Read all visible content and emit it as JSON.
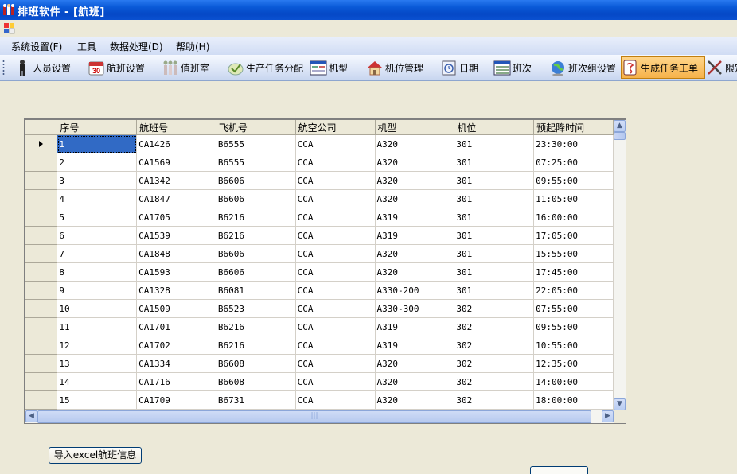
{
  "window": {
    "title": "排班软件 - [航班]"
  },
  "menu": [
    {
      "label": "系统设置(F)"
    },
    {
      "label": "工具"
    },
    {
      "label": "数据处理(D)"
    },
    {
      "label": "帮助(H)"
    }
  ],
  "toolbar": [
    {
      "label": "人员设置",
      "icon": "person-icon"
    },
    {
      "label": "航班设置",
      "icon": "calendar-30-icon"
    },
    {
      "label": "值班室",
      "icon": "people-group-icon"
    },
    {
      "label": "生产任务分配",
      "icon": "task-assign-icon"
    },
    {
      "label": "机型",
      "icon": "window-form-icon"
    },
    {
      "label": "机位管理",
      "icon": "house-icon"
    },
    {
      "label": "日期",
      "icon": "date-icon"
    },
    {
      "label": "班次",
      "icon": "form-list-icon"
    },
    {
      "label": "班次组设置",
      "icon": "globe-icon"
    },
    {
      "label": "生成任务工单",
      "icon": "generate-worksheet-icon",
      "active": true
    },
    {
      "label": "限定",
      "icon": "tools-cross-icon"
    }
  ],
  "grid": {
    "columns": [
      "序号",
      "航班号",
      "飞机号",
      "航空公司",
      "机型",
      "机位",
      "预起降时间"
    ],
    "rows": [
      [
        "1",
        "CA1426",
        "B6555",
        "CCA",
        "A320",
        "301",
        "23:30:00"
      ],
      [
        "2",
        "CA1569",
        "B6555",
        "CCA",
        "A320",
        "301",
        "07:25:00"
      ],
      [
        "3",
        "CA1342",
        "B6606",
        "CCA",
        "A320",
        "301",
        "09:55:00"
      ],
      [
        "4",
        "CA1847",
        "B6606",
        "CCA",
        "A320",
        "301",
        "11:05:00"
      ],
      [
        "5",
        "CA1705",
        "B6216",
        "CCA",
        "A319",
        "301",
        "16:00:00"
      ],
      [
        "6",
        "CA1539",
        "B6216",
        "CCA",
        "A319",
        "301",
        "17:05:00"
      ],
      [
        "7",
        "CA1848",
        "B6606",
        "CCA",
        "A320",
        "301",
        "15:55:00"
      ],
      [
        "8",
        "CA1593",
        "B6606",
        "CCA",
        "A320",
        "301",
        "17:45:00"
      ],
      [
        "9",
        "CA1328",
        "B6081",
        "CCA",
        "A330-200",
        "301",
        "22:05:00"
      ],
      [
        "10",
        "CA1509",
        "B6523",
        "CCA",
        "A330-300",
        "302",
        "07:55:00"
      ],
      [
        "11",
        "CA1701",
        "B6216",
        "CCA",
        "A319",
        "302",
        "09:55:00"
      ],
      [
        "12",
        "CA1702",
        "B6216",
        "CCA",
        "A319",
        "302",
        "10:55:00"
      ],
      [
        "13",
        "CA1334",
        "B6608",
        "CCA",
        "A320",
        "302",
        "12:35:00"
      ],
      [
        "14",
        "CA1716",
        "B6608",
        "CCA",
        "A320",
        "302",
        "14:00:00"
      ],
      [
        "15",
        "CA1709",
        "B6731",
        "CCA",
        "A320",
        "302",
        "18:00:00"
      ]
    ]
  },
  "buttons": {
    "import_label": "导入excel航班信息"
  }
}
